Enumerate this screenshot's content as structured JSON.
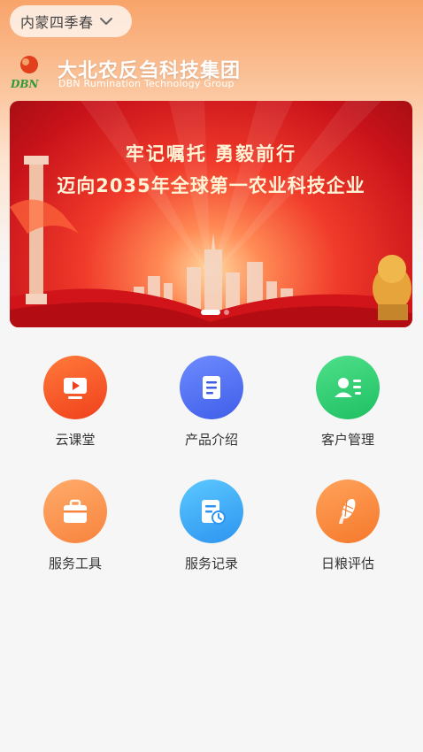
{
  "header": {
    "region_label": "内蒙四季春",
    "logo_text": "DBN",
    "brand_name": "大北农反刍科技集团",
    "brand_subtitle": "DBN Rumination Technology Group"
  },
  "banner": {
    "line1": "牢记嘱托 勇毅前行",
    "line2": "迈向2035年全球第一农业科技企业",
    "slide_count": 2,
    "active_slide": 1
  },
  "features": [
    {
      "label": "云课堂",
      "icon": "video-lesson-icon",
      "color": "#f0401c"
    },
    {
      "label": "产品介绍",
      "icon": "document-icon",
      "color": "#3f5ee8"
    },
    {
      "label": "客户管理",
      "icon": "contact-card-icon",
      "color": "#1fbf62"
    },
    {
      "label": "服务工具",
      "icon": "toolbox-icon",
      "color": "#f7843e"
    },
    {
      "label": "服务记录",
      "icon": "record-clock-icon",
      "color": "#2d94f0"
    },
    {
      "label": "日粮评估",
      "icon": "corn-icon",
      "color": "#f5792c"
    }
  ]
}
